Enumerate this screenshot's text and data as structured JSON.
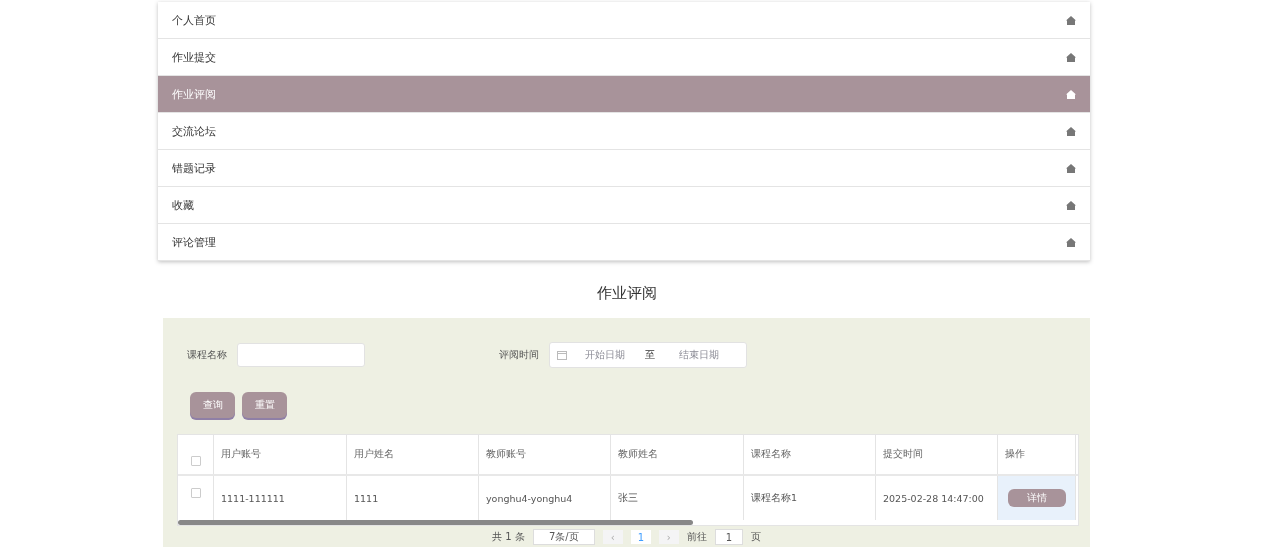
{
  "menu": [
    {
      "label": "个人首页",
      "selected": false
    },
    {
      "label": "作业提交",
      "selected": false
    },
    {
      "label": "作业评阅",
      "selected": true
    },
    {
      "label": "交流论坛",
      "selected": false
    },
    {
      "label": "错题记录",
      "selected": false
    },
    {
      "label": "收藏",
      "selected": false
    },
    {
      "label": "评论管理",
      "selected": false
    }
  ],
  "page_title": "作业评阅",
  "search": {
    "course_label": "课程名称",
    "time_label": "评阅时间",
    "start_placeholder": "开始日期",
    "range_separator": "至",
    "end_placeholder": "结束日期"
  },
  "buttons": [
    "查询",
    "重置"
  ],
  "table": {
    "header_checked": false,
    "columns": [
      "用户账号",
      "用户姓名",
      "教师账号",
      "教师姓名",
      "课程名称",
      "提交时间",
      "操作"
    ],
    "rows": [
      {
        "checked": false,
        "cells": [
          "1111-111111",
          "1111",
          "yonghu4-yonghu4",
          "张三",
          "课程名称1",
          "2025-02-28 14:47:00"
        ],
        "action": "详情"
      }
    ]
  },
  "pagination": {
    "total": "共 1 条",
    "page_size": "7条/页",
    "prev": "‹",
    "page": "1",
    "next": "›",
    "goto_label": "前往",
    "goto_value": "1",
    "goto_suffix": "页"
  }
}
